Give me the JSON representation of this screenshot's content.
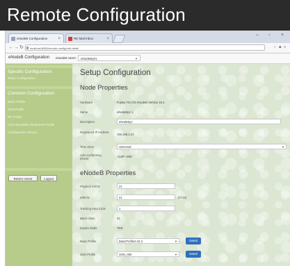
{
  "banner": {
    "title": "Remote Configuration"
  },
  "browser": {
    "tabs": [
      {
        "label": "eNodeB Configuration"
      },
      {
        "label": "RE Mail Inbox"
      }
    ],
    "address": "localhost:8080/remote-config/enb-detail",
    "window_controls": [
      "–",
      "▫",
      "×"
    ]
  },
  "app": {
    "title": "eNodeB Configuration",
    "enb_select_label": "eNodeB name:",
    "enb_select_value": "eNodeBy01"
  },
  "sidebar": {
    "specific_heading": "Specific Configuration",
    "specific_items": [
      "Setup Configuration"
    ],
    "common_heading": "Common Configuration",
    "common_items": [
      "Basic Profile",
      "SON Profile",
      "RF Profile",
      "Cell Association Response Profile",
      "Configuration History"
    ],
    "buttons": [
      "Return Home",
      "Logout"
    ]
  },
  "content": {
    "title": "Setup Configuration",
    "node_section": "Node Properties",
    "node_props": [
      {
        "label": "Hardware",
        "value": "Fujitsu TD-LTE eNodeB Version 15.4"
      },
      {
        "label": "Name",
        "value": "eNodeBy1-1"
      },
      {
        "label": "Description",
        "value": "eNodeBy1"
      },
      {
        "label": "Registered IP Address",
        "value": "192.168.1.21"
      },
      {
        "label": "Time Zone",
        "value": "Universal"
      },
      {
        "label": "Auto-conforming (RSSI)",
        "value": "-110P   -40M"
      }
    ],
    "enb_section": "eNodeB Properties",
    "enb_props": [
      {
        "label": "Physical Cell ID",
        "value": "21"
      },
      {
        "label": "eNB ID",
        "value": "21",
        "note": "(0×15)"
      },
      {
        "label": "Tracking Area Code",
        "value": "1"
      },
      {
        "label": "Band Class",
        "value": "41"
      },
      {
        "label": "Duplex Mode",
        "value": "TDD"
      },
      {
        "label": "Basic Profile",
        "value": "BasicProfile2-22.3",
        "button": "Detail"
      },
      {
        "label": "SON Profile",
        "value": "SON_000",
        "button": "Detail"
      }
    ]
  }
}
